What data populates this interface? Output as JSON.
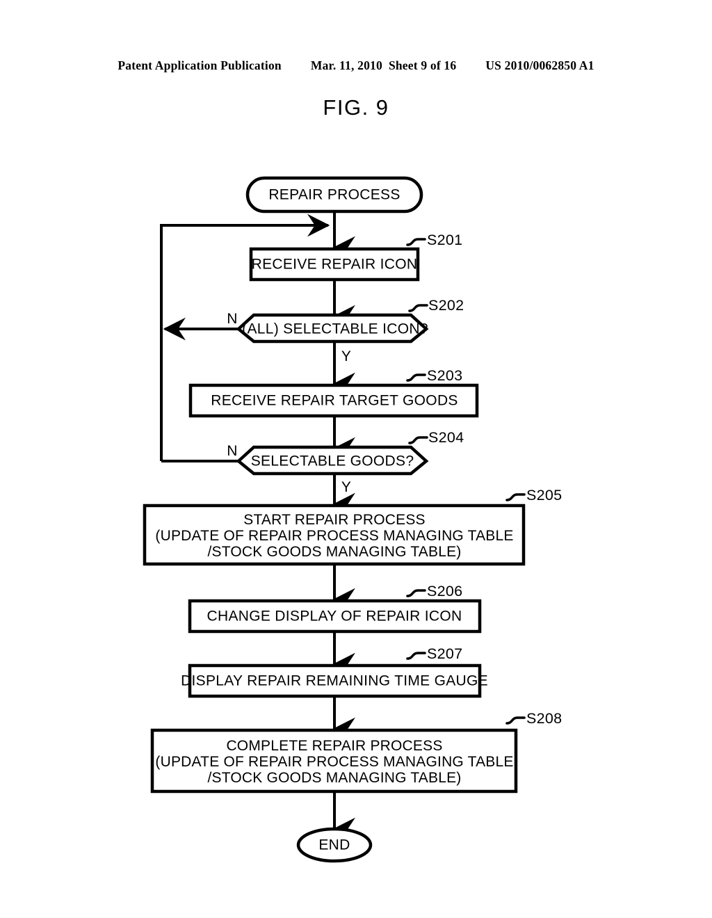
{
  "header": {
    "publication": "Patent Application Publication",
    "date": "Mar. 11, 2010",
    "sheet": "Sheet 9 of 16",
    "patent_number": "US 2010/0062850 A1"
  },
  "figure": {
    "title": "FIG. 9"
  },
  "flowchart": {
    "start_node": {
      "label": "REPAIR PROCESS",
      "shape": "oval"
    },
    "end_node": {
      "label": "END",
      "shape": "oval"
    },
    "steps": [
      {
        "id": "S201",
        "shape": "process",
        "lines": [
          "RECEIVE REPAIR ICON"
        ]
      },
      {
        "id": "S202",
        "shape": "decision",
        "lines": [
          "(ALL) SELECTABLE ICON?"
        ],
        "no_label": "N",
        "yes_label": "Y"
      },
      {
        "id": "S203",
        "shape": "process",
        "lines": [
          "RECEIVE REPAIR TARGET GOODS"
        ]
      },
      {
        "id": "S204",
        "shape": "decision",
        "lines": [
          "SELECTABLE GOODS?"
        ],
        "no_label": "N",
        "yes_label": "Y"
      },
      {
        "id": "S205",
        "shape": "process",
        "lines": [
          "START REPAIR PROCESS",
          "(UPDATE OF REPAIR PROCESS MANAGING TABLE",
          "/STOCK GOODS MANAGING TABLE)"
        ]
      },
      {
        "id": "S206",
        "shape": "process",
        "lines": [
          "CHANGE DISPLAY OF REPAIR ICON"
        ]
      },
      {
        "id": "S207",
        "shape": "process",
        "lines": [
          "DISPLAY REPAIR REMAINING TIME GAUGE"
        ]
      },
      {
        "id": "S208",
        "shape": "process",
        "lines": [
          "COMPLETE REPAIR PROCESS",
          "(UPDATE OF REPAIR PROCESS MANAGING TABLE",
          "/STOCK GOODS MANAGING TABLE)"
        ]
      }
    ]
  },
  "colors": {
    "ink": "#000000",
    "paper": "#ffffff"
  }
}
